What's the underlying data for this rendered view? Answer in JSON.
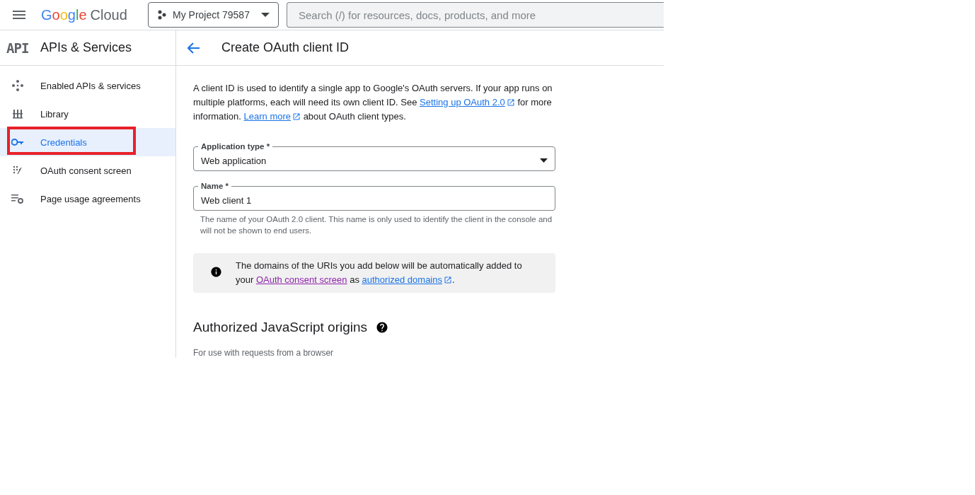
{
  "topbar": {
    "logo": [
      "Google",
      "Cloud"
    ],
    "project": "My Project 79587",
    "search": {
      "placeholder": "Search (/) for resources, docs, products, and more"
    }
  },
  "sidebar": {
    "logo": "API",
    "title": "APIs & Services",
    "items": [
      {
        "label": "Enabled APIs & services",
        "kind": "apis",
        "selected": false,
        "highlighted": false
      },
      {
        "label": "Library",
        "kind": "library",
        "selected": false,
        "highlighted": false
      },
      {
        "label": "Credentials",
        "kind": "key",
        "selected": true,
        "highlighted": true
      },
      {
        "label": "OAuth consent screen",
        "kind": "consent",
        "selected": false,
        "highlighted": false
      },
      {
        "label": "Page usage agreements",
        "kind": "settings",
        "selected": false,
        "highlighted": false
      }
    ]
  },
  "page": {
    "title": "Create OAuth client ID",
    "intro": [
      {
        "kind": "text",
        "text": "A client ID is used to identify a single app to Google's OAuth servers. If your app runs on multiple platforms, each will need its own client ID. See "
      },
      {
        "kind": "link",
        "text": "Setting up OAuth 2.0",
        "external": true,
        "visited": false
      },
      {
        "kind": "text",
        "text": " for more information. "
      },
      {
        "kind": "link",
        "text": "Learn more",
        "external": true,
        "visited": false
      },
      {
        "kind": "text",
        "text": " about OAuth client types."
      }
    ],
    "application_type": {
      "label": "Application type *",
      "value": "Web application"
    },
    "name": {
      "label": "Name *",
      "value": "Web client 1",
      "hint": "The name of your OAuth 2.0 client. This name is only used to identify the client in the console and will not be shown to end users."
    },
    "notice": [
      {
        "kind": "text",
        "text": "The domains of the URIs you add below will be automatically added to your "
      },
      {
        "kind": "link",
        "text": "OAuth consent screen",
        "external": false,
        "visited": true
      },
      {
        "kind": "text",
        "text": " as "
      },
      {
        "kind": "link",
        "text": "authorized domains",
        "external": true,
        "visited": false
      },
      {
        "kind": "text",
        "text": "."
      }
    ],
    "origins": {
      "title": "Authorized JavaScript origins",
      "subtitle": "For use with requests from a browser"
    }
  }
}
